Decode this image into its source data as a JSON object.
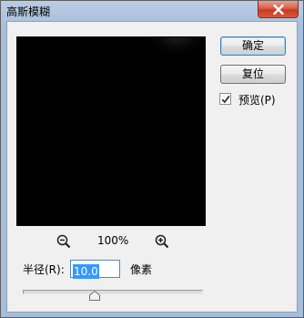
{
  "window": {
    "title": "高斯模糊"
  },
  "buttons": {
    "ok": "确定",
    "reset": "复位"
  },
  "preview_checkbox": {
    "label": "预览(P)",
    "checked": true
  },
  "zoom": {
    "level": "100%",
    "zoom_out_icon": "zoom-out-icon",
    "zoom_in_icon": "zoom-in-icon"
  },
  "radius": {
    "label": "半径(R):",
    "value": "10.0",
    "unit": "像素"
  },
  "slider": {
    "value": 10.0
  },
  "colors": {
    "titlebar": "#a7bedb",
    "close_button": "#c73b22",
    "selection": "#3399ff",
    "dialog_bg": "#f0f0f0"
  }
}
